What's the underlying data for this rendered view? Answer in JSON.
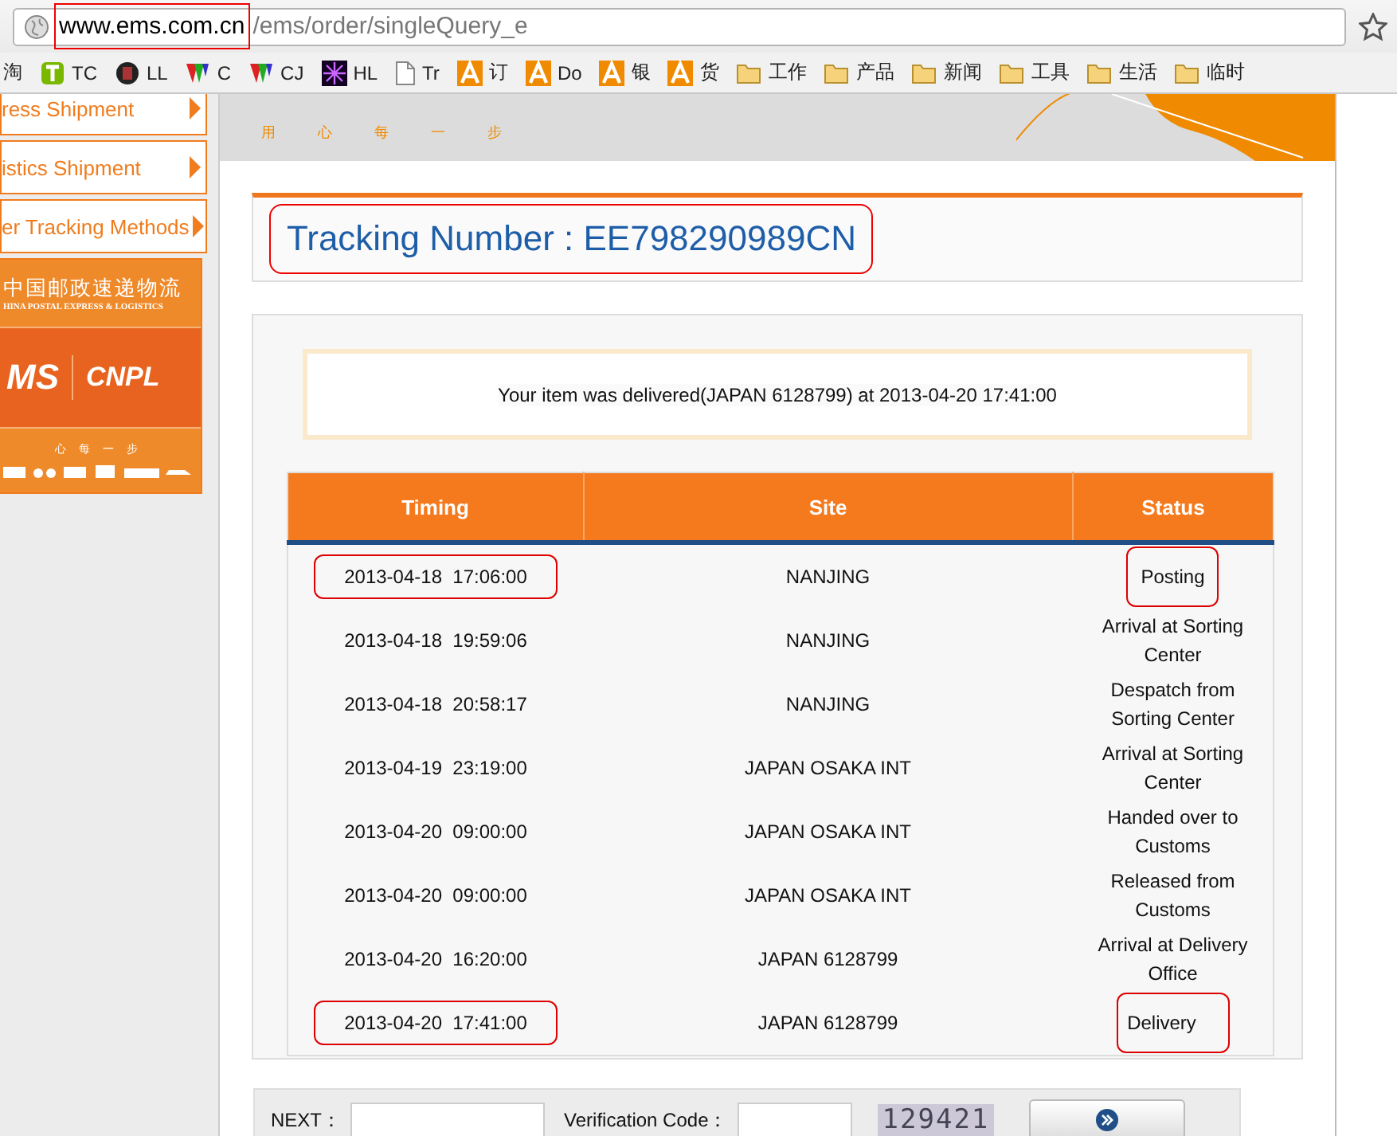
{
  "browser": {
    "url_host": "www.ems.com.cn",
    "url_path": "/ems/order/singleQuery_e",
    "url_host_marked": true,
    "bookmarks": [
      {
        "kind": "text",
        "label": "淘"
      },
      {
        "kind": "tc",
        "label": "TC"
      },
      {
        "kind": "ll",
        "label": "LL"
      },
      {
        "kind": "prism",
        "label": "C"
      },
      {
        "kind": "prism",
        "label": "CJ"
      },
      {
        "kind": "hl",
        "label": "HL"
      },
      {
        "kind": "page",
        "label": "Tr"
      },
      {
        "kind": "orange",
        "label": "订"
      },
      {
        "kind": "orange",
        "label": "Do"
      },
      {
        "kind": "orange",
        "label": "银"
      },
      {
        "kind": "orange",
        "label": "货"
      },
      {
        "kind": "folder",
        "label": "工作"
      },
      {
        "kind": "folder",
        "label": "产品"
      },
      {
        "kind": "folder",
        "label": "新闻"
      },
      {
        "kind": "folder",
        "label": "工具"
      },
      {
        "kind": "folder",
        "label": "生活"
      },
      {
        "kind": "folder",
        "label": "临时"
      }
    ]
  },
  "sidebar": {
    "items": [
      {
        "label": "ress Shipment"
      },
      {
        "label": "istics Shipment"
      },
      {
        "label": "er Tracking Methods"
      }
    ],
    "logo": {
      "chinese_name": "中国邮政速递物流",
      "english_name": "HINA POSTAL EXPRESS & LOGISTICS",
      "brand_1": "MS",
      "brand_2": "CNPL",
      "slogan": "心 每 一 步"
    }
  },
  "banner": {
    "slogan": "用 心 每 一 步"
  },
  "tracking": {
    "label": "Tracking Number : EE798290989CN",
    "marked": true
  },
  "message": "Your item was delivered(JAPAN 6128799) at 2013-04-20 17:41:00",
  "table": {
    "columns": [
      "Timing",
      "Site",
      "Status"
    ],
    "rows": [
      {
        "timing": "2013-04-18  17:06:00",
        "site": "NANJING",
        "status": "Posting",
        "timing_marked": true,
        "status_marked": true
      },
      {
        "timing": "2013-04-18  19:59:06",
        "site": "NANJING",
        "status": "Arrival at Sorting Center",
        "timing_marked": false,
        "status_marked": false
      },
      {
        "timing": "2013-04-18  20:58:17",
        "site": "NANJING",
        "status": "Despatch from Sorting Center",
        "timing_marked": false,
        "status_marked": false
      },
      {
        "timing": "2013-04-19  23:19:00",
        "site": "JAPAN OSAKA INT",
        "status": "Arrival at Sorting Center",
        "timing_marked": false,
        "status_marked": false
      },
      {
        "timing": "2013-04-20  09:00:00",
        "site": "JAPAN OSAKA INT",
        "status": "Handed over to Customs",
        "timing_marked": false,
        "status_marked": false
      },
      {
        "timing": "2013-04-20  09:00:00",
        "site": "JAPAN OSAKA INT",
        "status": "Released from Customs",
        "timing_marked": false,
        "status_marked": false
      },
      {
        "timing": "2013-04-20  16:20:00",
        "site": "JAPAN 6128799",
        "status": "Arrival at Delivery Office",
        "timing_marked": false,
        "status_marked": false
      },
      {
        "timing": "2013-04-20  17:41:00",
        "site": "JAPAN 6128799",
        "status": "Delivery",
        "timing_marked": true,
        "status_marked": true
      }
    ]
  },
  "form": {
    "next_label": "NEXT：",
    "code_label": "Verification Code：",
    "captcha": "129421"
  }
}
